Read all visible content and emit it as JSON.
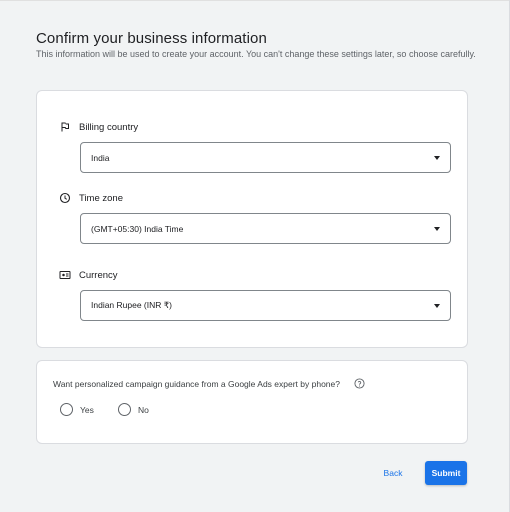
{
  "header": {
    "title": "Confirm your business information",
    "description": "This information will be used to create your account. You can't change these settings later, so choose carefully."
  },
  "fields": {
    "billing_country": {
      "label": "Billing country",
      "value": "India",
      "icon": "flag-icon"
    },
    "time_zone": {
      "label": "Time zone",
      "value": "(GMT+05:30) India Time",
      "icon": "clock-icon"
    },
    "currency": {
      "label": "Currency",
      "value": "Indian Rupee (INR ₹)",
      "icon": "currency-icon"
    }
  },
  "phone_guidance": {
    "question": "Want personalized campaign guidance from a Google Ads expert by phone?",
    "options": {
      "yes": "Yes",
      "no": "No"
    }
  },
  "actions": {
    "back": "Back",
    "submit": "Submit"
  },
  "colors": {
    "accent": "#1a73e8",
    "background": "#f1f3f4",
    "card": "#ffffff",
    "border": "#dadce0"
  }
}
